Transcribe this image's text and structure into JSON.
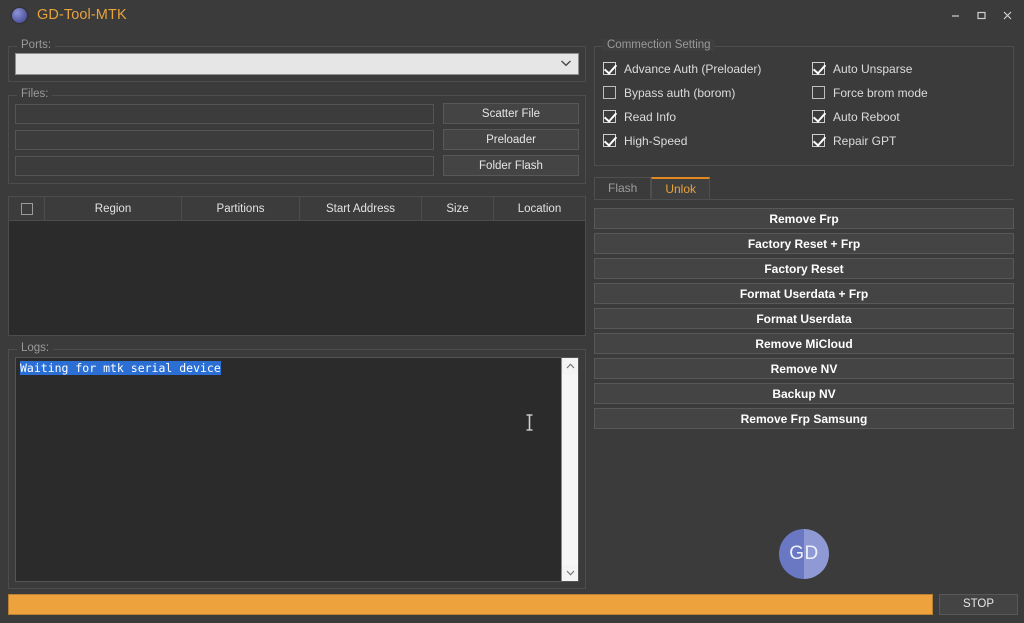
{
  "window": {
    "title": "GD-Tool-MTK",
    "icon": "gd-app-icon",
    "minimize": "minimize-icon",
    "maximize": "maximize-icon",
    "close": "close-icon"
  },
  "ports": {
    "legend": "Ports:",
    "selected": "",
    "chevron": "▾"
  },
  "files": {
    "legend": "Files:",
    "rows": [
      {
        "value": "",
        "button": "Scatter File"
      },
      {
        "value": "",
        "button": "Preloader"
      },
      {
        "value": "",
        "button": "Folder Flash"
      }
    ]
  },
  "partition_table": {
    "columns": [
      "",
      "Region",
      "Partitions",
      "Start Address",
      "Size",
      "Location"
    ],
    "rows": []
  },
  "logs": {
    "legend": "Logs:",
    "lines": [
      "Waiting for mtk serial device"
    ],
    "scroll_up": "▲",
    "scroll_down": "▼"
  },
  "connection": {
    "legend": "Commection Setting",
    "left_column": [
      {
        "label": "Advance Auth (Preloader)",
        "checked": true
      },
      {
        "label": "Bypass auth (borom)",
        "checked": false
      },
      {
        "label": "Read Info",
        "checked": true
      },
      {
        "label": "High-Speed",
        "checked": true
      }
    ],
    "right_column": [
      {
        "label": "Auto Unsparse",
        "checked": true
      },
      {
        "label": "Force brom mode",
        "checked": false
      },
      {
        "label": "Auto Reboot",
        "checked": true
      },
      {
        "label": "Repair GPT",
        "checked": true
      }
    ]
  },
  "tabs": [
    {
      "label": "Flash",
      "active": false
    },
    {
      "label": "Unlok",
      "active": true
    }
  ],
  "actions": [
    "Remove Frp",
    "Factory Reset + Frp",
    "Factory Reset",
    "Format Userdata + Frp",
    "Format Userdata",
    "Remove MiCloud",
    "Remove NV",
    "Backup NV",
    "Remove Frp Samsung"
  ],
  "brand": {
    "text": "GD"
  },
  "bottom": {
    "progress_percent": 100,
    "stop_label": "STOP"
  },
  "colors": {
    "accent": "#e8a33d",
    "progress": "#eda23e",
    "window_bg": "#3b3b3b",
    "panel_bg": "#3f3f3f",
    "field_bg": "#2b2b2b",
    "selection": "#2b6fd4"
  }
}
